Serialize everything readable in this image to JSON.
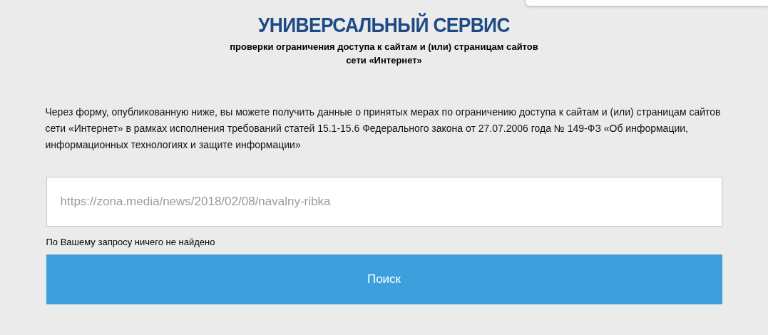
{
  "header": {
    "title": "УНИВЕРСАЛЬНЫЙ СЕРВИС",
    "subtitle_lines": [
      "проверки ограничения доступа к сайтам и (или) страницам сайтов",
      "сети «Интернет»"
    ]
  },
  "description": "Через форму, опубликованную ниже, вы можете получить данные о принятых мерах по ограничению доступа к сайтам и (или) страницам сайтов сети «Интернет» в рамках исполнения требований статей 15.1-15.6 Федерального закона от 27.07.2006 года № 149-ФЗ «Об информации, информационных технологиях и защите информации»",
  "search": {
    "placeholder": "https://zona.media/news/2018/02/08/navalny-ribka"
  },
  "result_message": "По Вашему запросу ничего не найдено",
  "buttons": [
    "Поиск"
  ]
}
